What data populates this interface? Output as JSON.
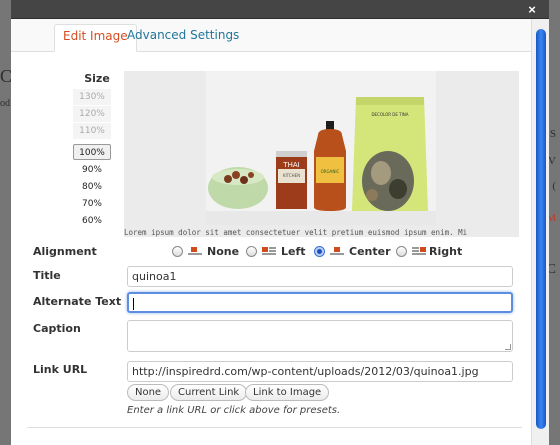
{
  "background": {
    "left_fragments": [
      "C",
      "od"
    ],
    "right_fragments": [
      "S",
      "V",
      "(",
      "M",
      "C"
    ]
  },
  "modal": {
    "close_glyph": "×",
    "tabs": [
      {
        "label": "Edit Image",
        "active": true
      },
      {
        "label": "Advanced Settings",
        "active": false
      }
    ]
  },
  "size_panel": {
    "label": "Size",
    "options": [
      {
        "label": "130%",
        "state": "disabled"
      },
      {
        "label": "120%",
        "state": "disabled"
      },
      {
        "label": "110%",
        "state": "disabled"
      },
      {
        "label": "100%",
        "state": "selected"
      },
      {
        "label": "90%",
        "state": "normal"
      },
      {
        "label": "80%",
        "state": "normal"
      },
      {
        "label": "70%",
        "state": "normal"
      },
      {
        "label": "60%",
        "state": "normal"
      }
    ]
  },
  "preview": {
    "product_labels": [
      "THAI",
      "KITCHEN",
      "ORGANIC",
      "DECOLOR DE TINA"
    ],
    "caption_text": "Lorem ipsum dolor sit amet consectetuer velit pretium euismod ipsum enim. Mi"
  },
  "form": {
    "alignment_label": "Alignment",
    "alignment_options": [
      {
        "label": "None",
        "checked": false
      },
      {
        "label": "Left",
        "checked": false
      },
      {
        "label": "Center",
        "checked": true
      },
      {
        "label": "Right",
        "checked": false
      }
    ],
    "title_label": "Title",
    "title_value": "quinoa1",
    "alt_label": "Alternate Text",
    "alt_value": "",
    "caption_label": "Caption",
    "caption_value": "",
    "link_label": "Link URL",
    "link_value": "http://inspiredrd.com/wp-content/uploads/2012/03/quinoa1.jpg",
    "preset_buttons": [
      "None",
      "Current Link",
      "Link to Image"
    ],
    "hint": "Enter a link URL or click above for presets."
  },
  "colors": {
    "active_tab": "#d54e21",
    "inactive_tab": "#21759b",
    "scroll_thumb": "#2d6fe0"
  }
}
